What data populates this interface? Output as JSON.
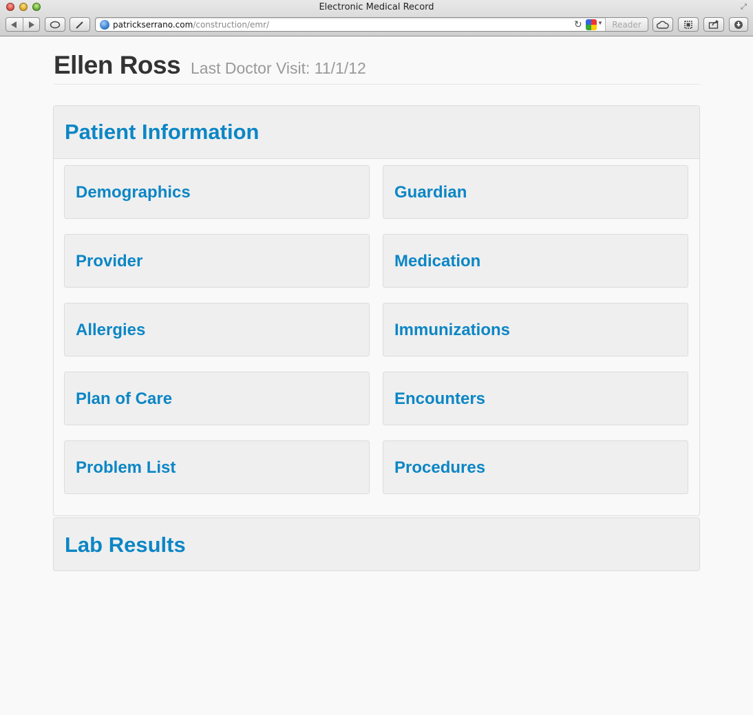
{
  "browser": {
    "window_title": "Electronic Medical Record",
    "url_domain": "patrickserrano.com",
    "url_path": "/construction/emr/",
    "reader_label": "Reader"
  },
  "patient": {
    "name": "Ellen Ross",
    "last_visit": "Last Doctor Visit: 11/1/12"
  },
  "sections": {
    "patient_info": {
      "title": "Patient Information",
      "tiles": [
        "Demographics",
        "Guardian",
        "Provider",
        "Medication",
        "Allergies",
        "Immunizations",
        "Plan of Care",
        "Encounters",
        "Problem List",
        "Procedures"
      ]
    },
    "lab_results": {
      "title": "Lab Results"
    }
  },
  "colors": {
    "accent": "#0c86c5",
    "heading": "#333333",
    "muted": "#999999",
    "panel": "#efefef",
    "page_bg": "#f9f9fa"
  }
}
